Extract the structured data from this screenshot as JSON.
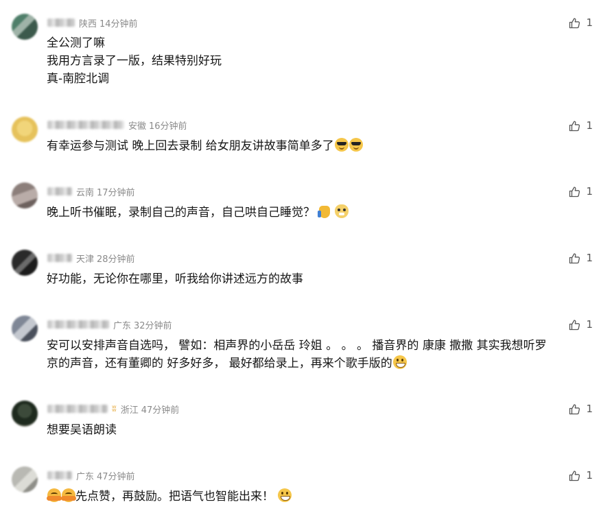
{
  "comments": [
    {
      "region": "陕西",
      "time": "14分钟前",
      "lines": [
        "全公测了嘛",
        "我用方言录了一版，结果特别好玩",
        "真-南腔北调"
      ],
      "likes": "1"
    },
    {
      "region": "安徽",
      "time": "16分钟前",
      "lines": [
        "有幸运参与测试  晚上回去录制 给女朋友讲故事简单多了"
      ],
      "likes": "1",
      "emojis": [
        "cool-face-emoji",
        "cool-face-emoji"
      ]
    },
    {
      "region": "云南",
      "time": "17分钟前",
      "lines": [
        "晚上听书催眠，录制自己的声音，自己哄自己睡觉？"
      ],
      "likes": "1",
      "emojis": [
        "thumbs-up-emoji",
        "doge-emoji"
      ]
    },
    {
      "region": "天津",
      "time": "28分钟前",
      "lines": [
        "好功能，无论你在哪里，听我给你讲述远方的故事"
      ],
      "likes": "1"
    },
    {
      "region": "广东",
      "time": "32分钟前",
      "lines": [
        "安可以安排声音自选吗，  譬如：相声界的小岳岳  玲姐 。 。 。  播音界的 康康 撒撒 其实我想听罗",
        "京的声音，还有董卿的 好多好多，  最好都给录上，再来个歌手版的"
      ],
      "likes": "1",
      "emojis": [
        "grin-emoji"
      ]
    },
    {
      "region": "浙江",
      "time": "47分钟前",
      "lines": [
        "想要吴语朗读"
      ],
      "likes": "1",
      "badge": "(("
    },
    {
      "region": "广东",
      "time": "47分钟前",
      "lines": [
        "先点赞，再鼓励。把语气也智能出来！"
      ],
      "likes": "1",
      "lead_emojis": [
        "hug-emoji",
        "hug-emoji"
      ],
      "emojis": [
        "grin-emoji"
      ]
    }
  ],
  "colors": {
    "meta_gray": "#8a8a8a",
    "text": "#161616",
    "like_gray": "#555555"
  }
}
